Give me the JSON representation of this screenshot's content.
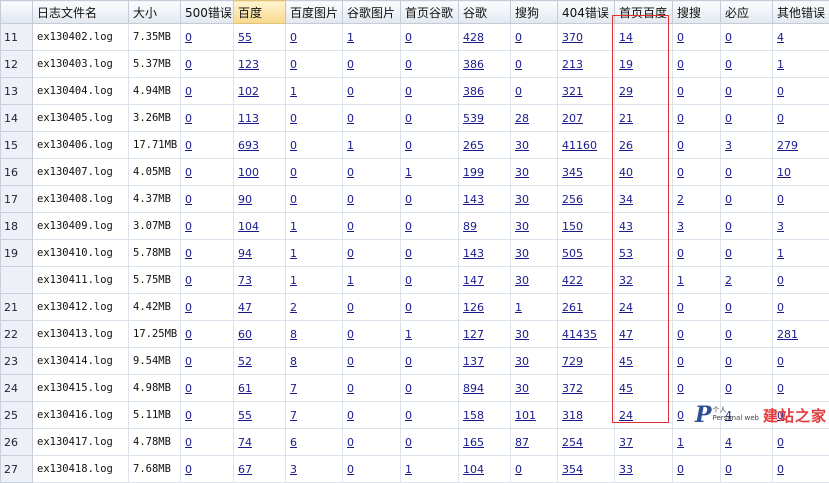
{
  "table": {
    "headers": [
      "",
      "日志文件名",
      "大小",
      "500错误",
      "百度",
      "百度图片",
      "谷歌图片",
      "首页谷歌",
      "谷歌",
      "搜狗",
      "404错误",
      "首页百度",
      "搜搜",
      "必应",
      "其他错误"
    ],
    "highlighted_header_index": 4,
    "rows": [
      {
        "num": "11",
        "file": "ex130402.log",
        "size": "7.35MB",
        "cells": [
          "0",
          "55",
          "0",
          "1",
          "0",
          "428",
          "0",
          "370",
          "14",
          "0",
          "0",
          "4"
        ]
      },
      {
        "num": "12",
        "file": "ex130403.log",
        "size": "5.37MB",
        "cells": [
          "0",
          "123",
          "0",
          "0",
          "0",
          "386",
          "0",
          "213",
          "19",
          "0",
          "0",
          "1"
        ]
      },
      {
        "num": "13",
        "file": "ex130404.log",
        "size": "4.94MB",
        "cells": [
          "0",
          "102",
          "1",
          "0",
          "0",
          "386",
          "0",
          "321",
          "29",
          "0",
          "0",
          "0"
        ]
      },
      {
        "num": "14",
        "file": "ex130405.log",
        "size": "3.26MB",
        "cells": [
          "0",
          "113",
          "0",
          "0",
          "0",
          "539",
          "28",
          "207",
          "21",
          "0",
          "0",
          "0"
        ]
      },
      {
        "num": "15",
        "file": "ex130406.log",
        "size": "17.71MB",
        "cells": [
          "0",
          "693",
          "0",
          "1",
          "0",
          "265",
          "30",
          "41160",
          "26",
          "0",
          "3",
          "279"
        ]
      },
      {
        "num": "16",
        "file": "ex130407.log",
        "size": "4.05MB",
        "cells": [
          "0",
          "100",
          "0",
          "0",
          "1",
          "199",
          "30",
          "345",
          "40",
          "0",
          "0",
          "10"
        ]
      },
      {
        "num": "17",
        "file": "ex130408.log",
        "size": "4.37MB",
        "cells": [
          "0",
          "90",
          "0",
          "0",
          "0",
          "143",
          "30",
          "256",
          "34",
          "2",
          "0",
          "0"
        ]
      },
      {
        "num": "18",
        "file": "ex130409.log",
        "size": "3.07MB",
        "cells": [
          "0",
          "104",
          "1",
          "0",
          "0",
          "89",
          "30",
          "150",
          "43",
          "3",
          "0",
          "3"
        ]
      },
      {
        "num": "19",
        "file": "ex130410.log",
        "size": "5.78MB",
        "cells": [
          "0",
          "94",
          "1",
          "0",
          "0",
          "143",
          "30",
          "505",
          "53",
          "0",
          "0",
          "1"
        ]
      },
      {
        "num": "",
        "file": "ex130411.log",
        "size": "5.75MB",
        "cells": [
          "0",
          "73",
          "1",
          "1",
          "0",
          "147",
          "30",
          "422",
          "32",
          "1",
          "2",
          "0"
        ]
      },
      {
        "num": "21",
        "file": "ex130412.log",
        "size": "4.42MB",
        "cells": [
          "0",
          "47",
          "2",
          "0",
          "0",
          "126",
          "1",
          "261",
          "24",
          "0",
          "0",
          "0"
        ]
      },
      {
        "num": "22",
        "file": "ex130413.log",
        "size": "17.25MB",
        "cells": [
          "0",
          "60",
          "8",
          "0",
          "1",
          "127",
          "30",
          "41435",
          "47",
          "0",
          "0",
          "281"
        ]
      },
      {
        "num": "23",
        "file": "ex130414.log",
        "size": "9.54MB",
        "cells": [
          "0",
          "52",
          "8",
          "0",
          "0",
          "137",
          "30",
          "729",
          "45",
          "0",
          "0",
          "0"
        ]
      },
      {
        "num": "24",
        "file": "ex130415.log",
        "size": "4.98MB",
        "cells": [
          "0",
          "61",
          "7",
          "0",
          "0",
          "894",
          "30",
          "372",
          "45",
          "0",
          "0",
          "0"
        ]
      },
      {
        "num": "25",
        "file": "ex130416.log",
        "size": "5.11MB",
        "cells": [
          "0",
          "55",
          "7",
          "0",
          "0",
          "158",
          "101",
          "318",
          "24",
          "0",
          "4",
          "0"
        ]
      },
      {
        "num": "26",
        "file": "ex130417.log",
        "size": "4.78MB",
        "cells": [
          "0",
          "74",
          "6",
          "0",
          "0",
          "165",
          "87",
          "254",
          "37",
          "1",
          "4",
          "0"
        ]
      },
      {
        "num": "27",
        "file": "ex130418.log",
        "size": "7.68MB",
        "cells": [
          "0",
          "67",
          "3",
          "0",
          "1",
          "104",
          "0",
          "354",
          "33",
          "0",
          "0",
          "0"
        ]
      }
    ]
  },
  "annotation": {
    "color": "#e03030",
    "column": "首页百度"
  },
  "watermark": {
    "logo_letter": "P",
    "small_text": "个人\nPersonal web",
    "brand_text": "建站之家"
  }
}
